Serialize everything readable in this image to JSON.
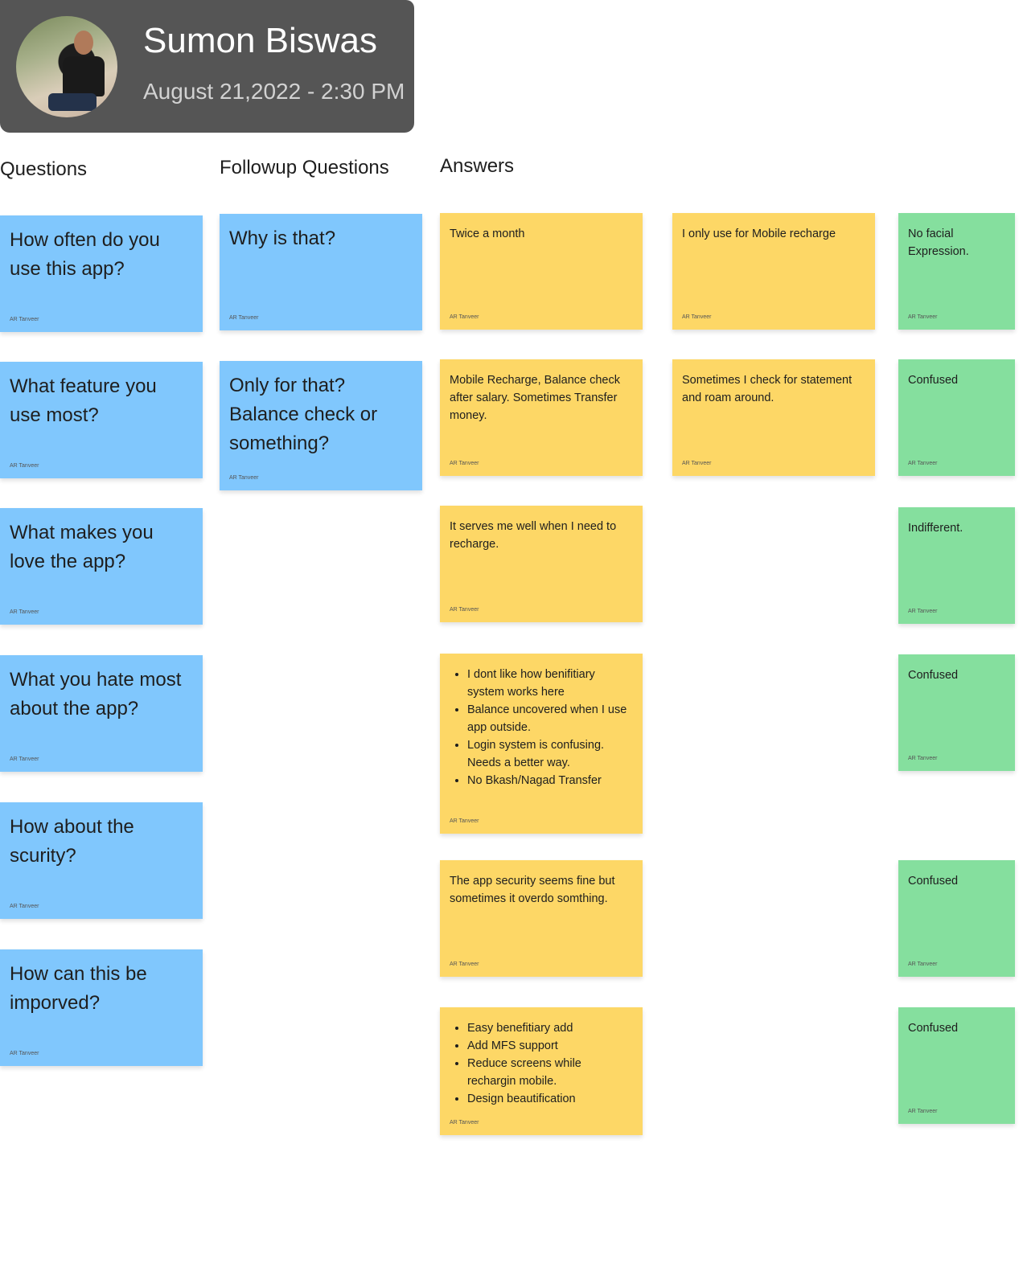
{
  "header": {
    "name": "Sumon Biswas",
    "datetime": "August 21,2022 - 2:30 PM"
  },
  "columns": {
    "questions": "Questions",
    "followup": "Followup Questions",
    "answers": "Answers"
  },
  "author": "AR Tanveer",
  "colors": {
    "question": "#80c7fd",
    "answer": "#fdd766",
    "expression": "#85df9e",
    "header": "#555555"
  },
  "questions": [
    "How often do you use this app?",
    "What feature you use most?",
    "What makes you love the app?",
    "What you hate most about the app?",
    "How about the scurity?",
    "How can this be imporved?"
  ],
  "followups": [
    "Why is that?",
    "Only for that? Balance check or something?"
  ],
  "answers": [
    {
      "text": "Twice a month"
    },
    {
      "text": "Mobile Recharge, Balance check after salary. Sometimes Transfer money."
    },
    {
      "text": "It serves me well when I need to recharge."
    },
    {
      "bullets": [
        "I dont like how benifitiary system works here",
        "Balance uncovered when I use app outside.",
        "Login system is confusing. Needs a better way.",
        "No Bkash/Nagad Transfer"
      ]
    },
    {
      "text": "The app security seems fine but sometimes it overdo somthing."
    },
    {
      "bullets": [
        "Easy benefitiary add",
        "Add MFS support",
        "Reduce screens while rechargin mobile.",
        "Design beautification"
      ]
    }
  ],
  "followup_answers": [
    "I only use for Mobile recharge",
    "Sometimes I check for statement and roam around."
  ],
  "expressions": [
    "No facial Expression.",
    "Confused",
    "Indifferent.",
    "Confused",
    "Confused",
    "Confused"
  ]
}
